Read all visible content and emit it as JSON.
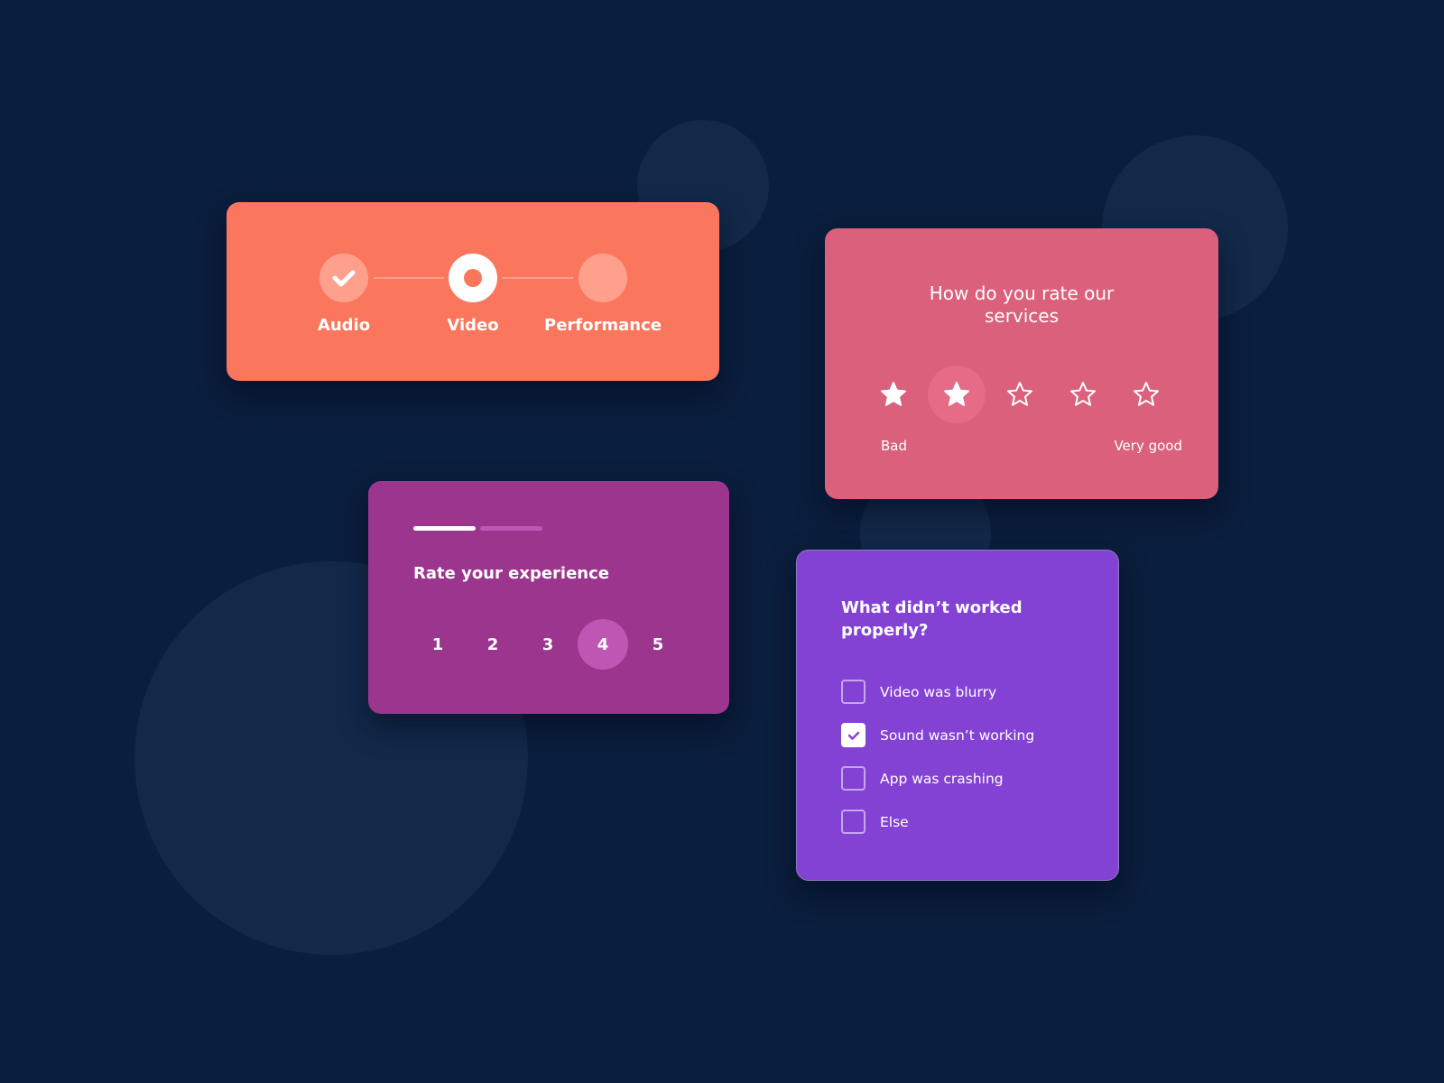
{
  "colors": {
    "background": "#0a1e3d",
    "stepper_card": "#fa765d",
    "stars_card": "#da607c",
    "rate_card": "#9b358d",
    "checklist_card": "#8442d5"
  },
  "stepper": {
    "steps": [
      {
        "label": "Audio",
        "state": "done",
        "icon": "check-icon"
      },
      {
        "label": "Video",
        "state": "current",
        "icon": "dot-icon"
      },
      {
        "label": "Performance",
        "state": "todo",
        "icon": ""
      }
    ]
  },
  "stars_rating": {
    "title": "How do you rate our services",
    "rating": 2,
    "max": 5,
    "hovered": 2,
    "low_label": "Bad",
    "high_label": "Very good"
  },
  "experience": {
    "progress_step": 1,
    "progress_total": 2,
    "title": "Rate your experience",
    "options": [
      "1",
      "2",
      "3",
      "4",
      "5"
    ],
    "selected": "4"
  },
  "issues": {
    "title": "What didn’t worked properly?",
    "options": [
      {
        "label": "Video was blurry",
        "checked": false
      },
      {
        "label": "Sound wasn’t working",
        "checked": true
      },
      {
        "label": "App was crashing",
        "checked": false
      },
      {
        "label": "Else",
        "checked": false
      }
    ]
  }
}
